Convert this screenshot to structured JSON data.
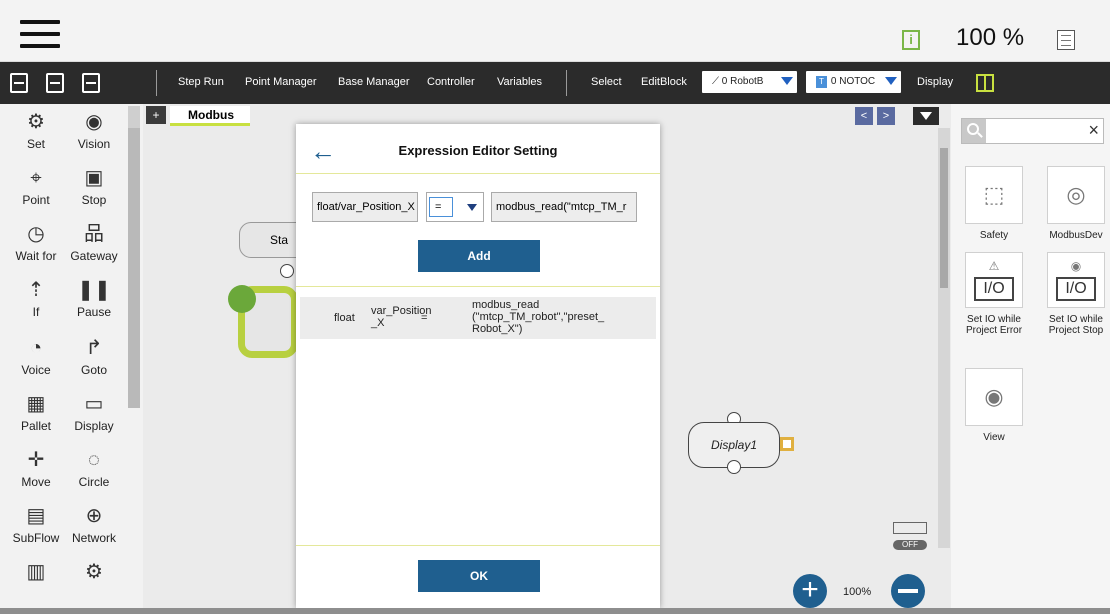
{
  "status_bar": {
    "speed": "100 %"
  },
  "toolbar": {
    "step_run": "Step Run",
    "point_manager": "Point Manager",
    "base_manager": "Base Manager",
    "controller": "Controller",
    "variables": "Variables",
    "select": "Select",
    "editblock": "EditBlock",
    "robot_base": "0 RobotB",
    "tool": "0 NOTOC",
    "tool_badge": "T",
    "display": "Display"
  },
  "palette": [
    {
      "label": "Set",
      "icon": "⚙"
    },
    {
      "label": "Vision",
      "icon": "◉"
    },
    {
      "label": "Point",
      "icon": "⌖"
    },
    {
      "label": "Stop",
      "icon": "▣"
    },
    {
      "label": "Wait for",
      "icon": "◷"
    },
    {
      "label": "Gateway",
      "icon": "品"
    },
    {
      "label": "If",
      "icon": "⇡"
    },
    {
      "label": "Pause",
      "icon": "❚❚"
    },
    {
      "label": "Voice",
      "icon": "◔"
    },
    {
      "label": "Goto",
      "icon": "↱"
    },
    {
      "label": "Pallet",
      "icon": "▦"
    },
    {
      "label": "Display",
      "icon": "▭"
    },
    {
      "label": "Move",
      "icon": "✛"
    },
    {
      "label": "Circle",
      "icon": "◌"
    },
    {
      "label": "SubFlow",
      "icon": "▤"
    },
    {
      "label": "Network",
      "icon": "⊕"
    },
    {
      "label": "",
      "icon": "▥"
    },
    {
      "label": "",
      "icon": "⚙"
    }
  ],
  "canvas": {
    "tab_add": "+",
    "tab_label": "Modbus",
    "nav_prev": "<",
    "nav_next": ">",
    "start_node": "Sta",
    "display_node": "Display1",
    "io_off": "OFF",
    "zoom_in": "+",
    "zoom_level": "100%"
  },
  "components": [
    {
      "label": "Safety",
      "icon": "⬚"
    },
    {
      "label": "ModbusDev",
      "icon": "◎"
    },
    {
      "label": "Set IO while Project Error",
      "icon": "⚠",
      "io": "I/O"
    },
    {
      "label": "Set IO while Project Stop",
      "icon": "◉",
      "io": "I/O"
    },
    {
      "label": "View",
      "icon": "◉"
    }
  ],
  "search": {
    "clear": "×"
  },
  "dialog": {
    "back": "←",
    "title": "Expression Editor Setting",
    "variable": "float/var_Position_X",
    "operator": "=",
    "expression": "modbus_read(\"mtcp_TM_r",
    "add_label": "Add",
    "row": {
      "type": "float",
      "var": "var_Position _X",
      "op": "=",
      "value": "modbus_read (\"mtcp_TM_robot\",\"preset_ Robot_X\")"
    },
    "ok_label": "OK"
  }
}
